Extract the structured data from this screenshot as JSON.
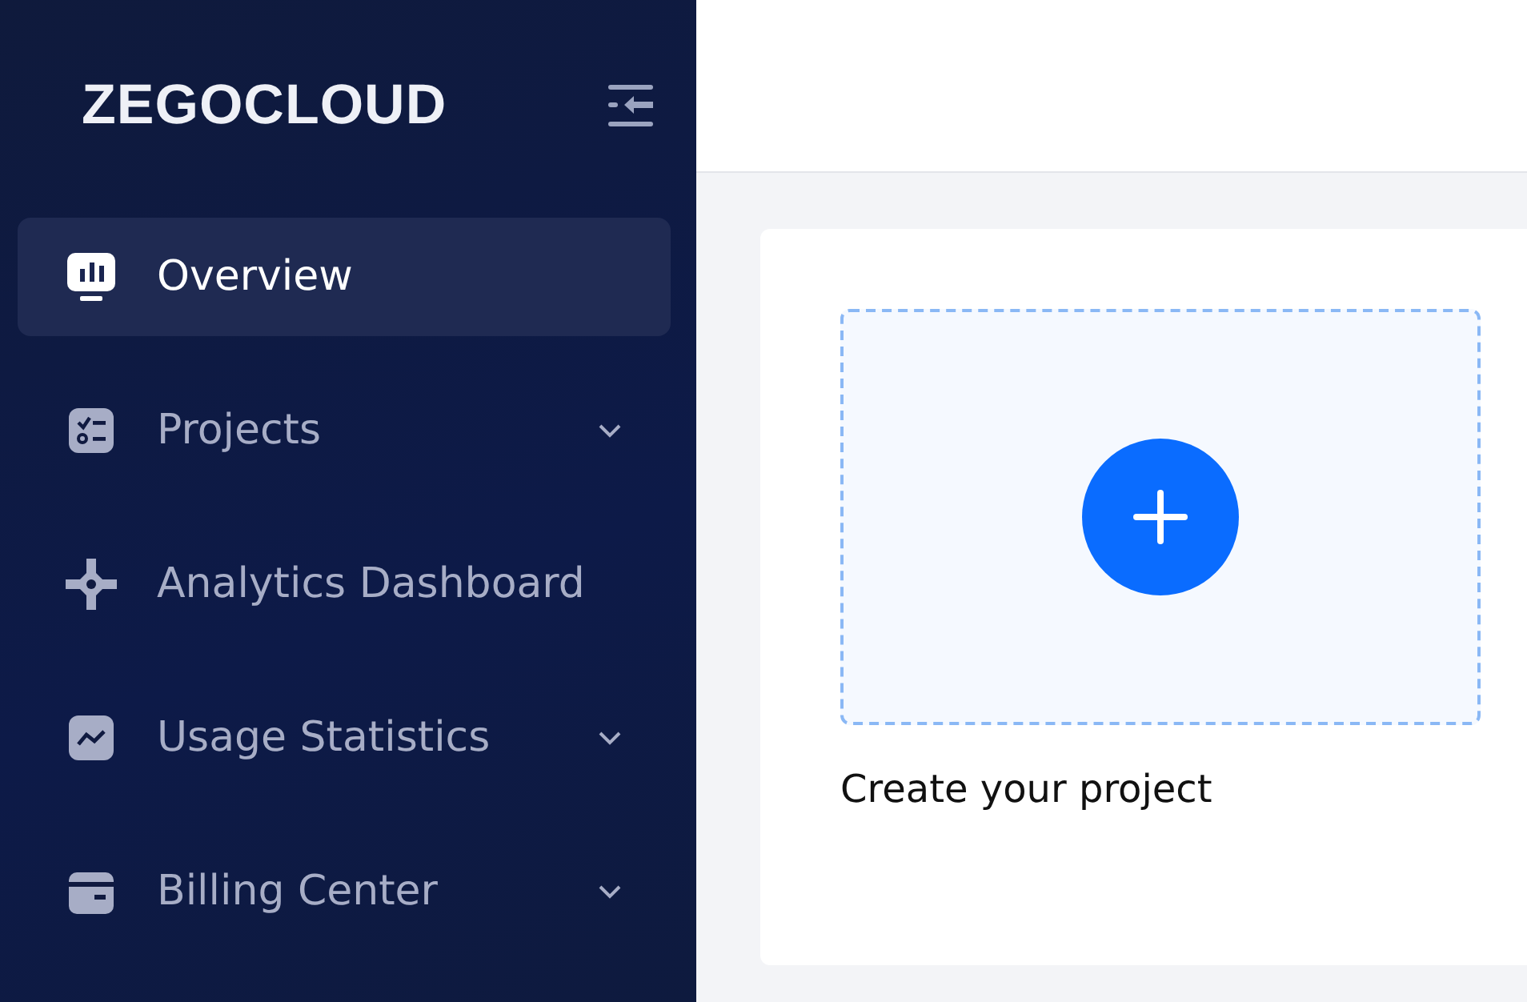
{
  "sidebar": {
    "logo": "ZEGOCLOUD",
    "items": [
      {
        "label": "Overview",
        "selected": true,
        "has_submenu": false
      },
      {
        "label": "Projects",
        "selected": false,
        "has_submenu": true
      },
      {
        "label": "Analytics Dashboard",
        "selected": false,
        "has_submenu": false
      },
      {
        "label": "Usage Statistics",
        "selected": false,
        "has_submenu": true
      },
      {
        "label": "Billing Center",
        "selected": false,
        "has_submenu": true
      }
    ]
  },
  "main": {
    "create_card": {
      "label": "Create your project"
    }
  }
}
